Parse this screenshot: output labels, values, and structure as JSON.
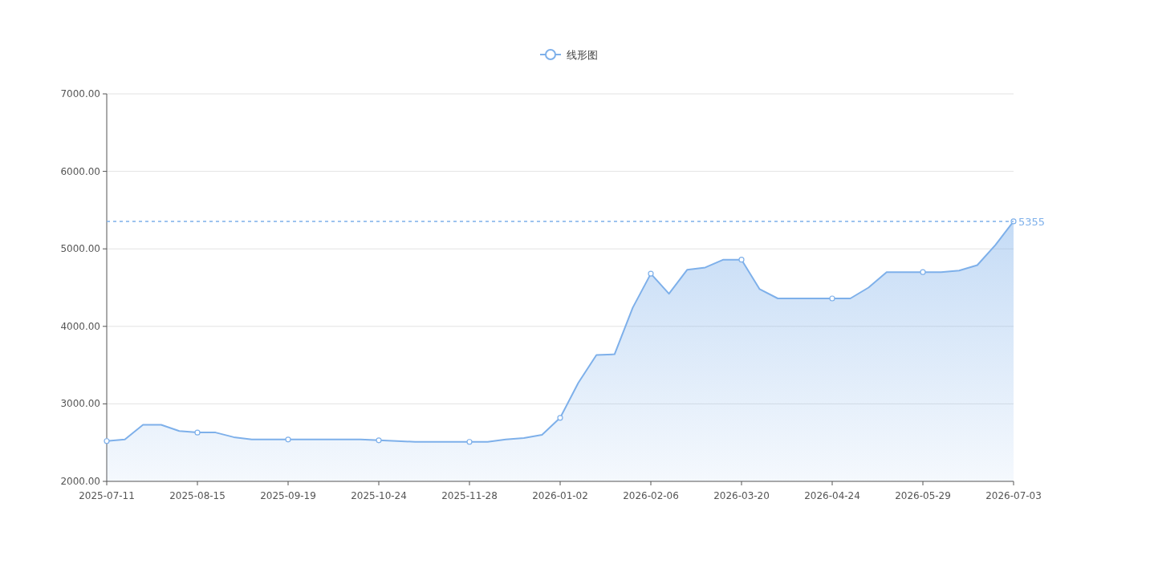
{
  "chart": {
    "chart_data": {
      "type": "area",
      "categories": [
        "2025-07-11",
        null,
        null,
        null,
        null,
        "2025-08-15",
        null,
        null,
        null,
        null,
        "2025-09-19",
        null,
        null,
        null,
        null,
        "2025-10-24",
        null,
        null,
        null,
        null,
        "2025-11-28",
        null,
        null,
        null,
        null,
        "2026-01-02",
        null,
        null,
        null,
        null,
        "2026-02-06",
        null,
        null,
        null,
        null,
        "2026-03-20",
        null,
        null,
        null,
        null,
        "2026-04-24",
        null,
        null,
        null,
        null,
        "2026-05-29",
        null,
        null,
        null,
        null,
        "2026-07-03"
      ],
      "series": [
        {
          "name": "线形图",
          "color": "#7eb0ea",
          "values": [
            2520,
            2540,
            2730,
            2730,
            2650,
            2630,
            2630,
            2570,
            2540,
            2540,
            2540,
            2540,
            2540,
            2540,
            2540,
            2530,
            2520,
            2510,
            2510,
            2510,
            2510,
            2510,
            2540,
            2560,
            2600,
            2820,
            3270,
            3630,
            3640,
            4240,
            4680,
            4420,
            4730,
            4760,
            4860,
            4860,
            4480,
            4360,
            4360,
            4360,
            4360,
            4360,
            4500,
            4700,
            4700,
            4700,
            4700,
            4720,
            4790,
            5050,
            5355
          ]
        }
      ],
      "ylim": [
        2000,
        7000
      ],
      "yticks": [
        {
          "value": 2000,
          "label": "2000.00"
        },
        {
          "value": 3000,
          "label": "3000.00"
        },
        {
          "value": 4000,
          "label": "4000.00"
        },
        {
          "value": 5000,
          "label": "5000.00"
        },
        {
          "value": 6000,
          "label": "6000.00"
        },
        {
          "value": 7000,
          "label": "7000.00"
        }
      ],
      "grid": true,
      "ref_lines": [
        {
          "axis": "y",
          "value": 5355,
          "label": "5355"
        }
      ]
    }
  }
}
